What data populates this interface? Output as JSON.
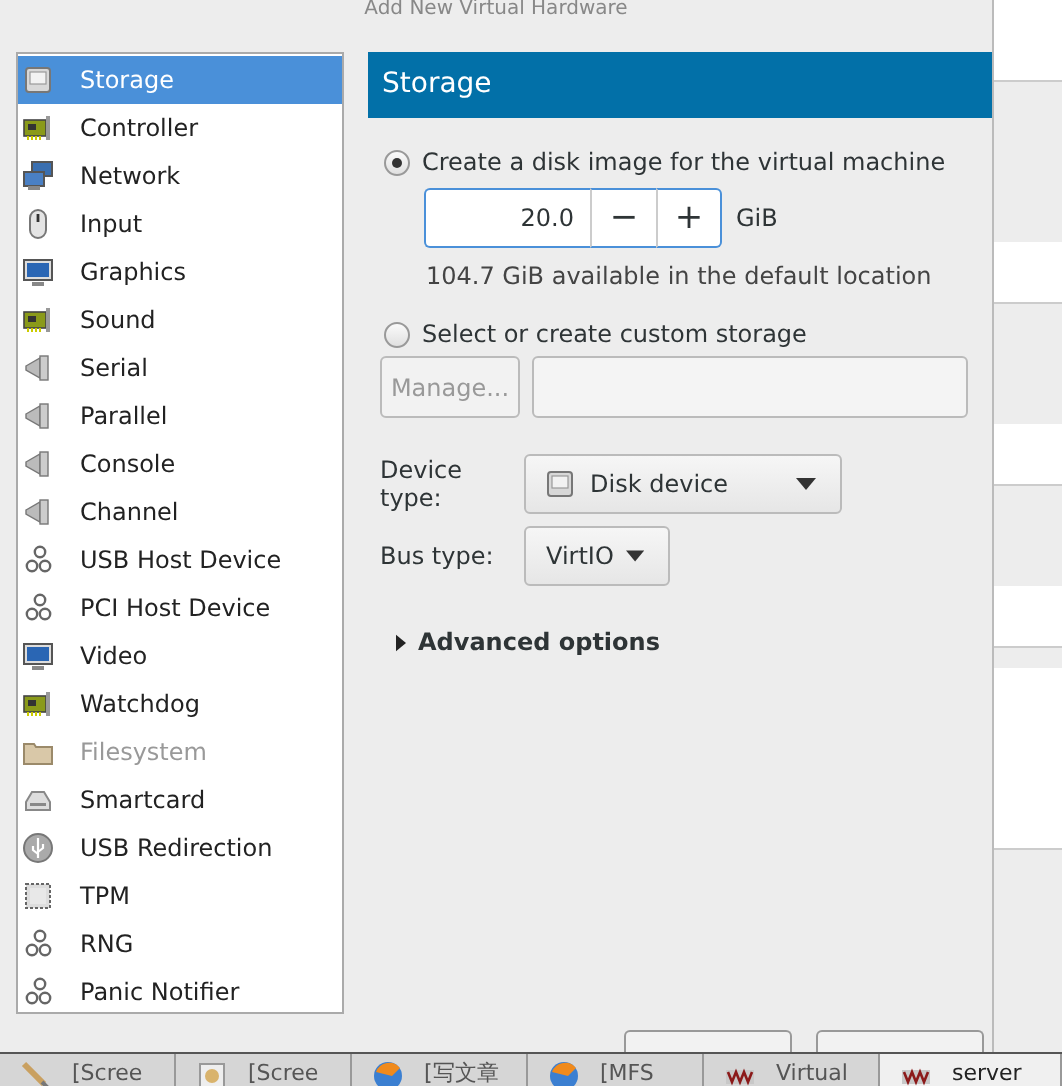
{
  "window": {
    "title": "Add New Virtual Hardware"
  },
  "hardware_list": [
    {
      "label": "Storage",
      "kind": "disk",
      "selected": true,
      "disabled": false
    },
    {
      "label": "Controller",
      "kind": "card",
      "selected": false,
      "disabled": false
    },
    {
      "label": "Network",
      "kind": "network",
      "selected": false,
      "disabled": false
    },
    {
      "label": "Input",
      "kind": "mouse",
      "selected": false,
      "disabled": false
    },
    {
      "label": "Graphics",
      "kind": "monitor",
      "selected": false,
      "disabled": false
    },
    {
      "label": "Sound",
      "kind": "card",
      "selected": false,
      "disabled": false
    },
    {
      "label": "Serial",
      "kind": "port",
      "selected": false,
      "disabled": false
    },
    {
      "label": "Parallel",
      "kind": "port",
      "selected": false,
      "disabled": false
    },
    {
      "label": "Console",
      "kind": "port",
      "selected": false,
      "disabled": false
    },
    {
      "label": "Channel",
      "kind": "port",
      "selected": false,
      "disabled": false
    },
    {
      "label": "USB Host Device",
      "kind": "gears",
      "selected": false,
      "disabled": false
    },
    {
      "label": "PCI Host Device",
      "kind": "gears",
      "selected": false,
      "disabled": false
    },
    {
      "label": "Video",
      "kind": "monitor",
      "selected": false,
      "disabled": false
    },
    {
      "label": "Watchdog",
      "kind": "card",
      "selected": false,
      "disabled": false
    },
    {
      "label": "Filesystem",
      "kind": "folder",
      "selected": false,
      "disabled": true
    },
    {
      "label": "Smartcard",
      "kind": "smartcard",
      "selected": false,
      "disabled": false
    },
    {
      "label": "USB Redirection",
      "kind": "usb",
      "selected": false,
      "disabled": false
    },
    {
      "label": "TPM",
      "kind": "chip",
      "selected": false,
      "disabled": false
    },
    {
      "label": "RNG",
      "kind": "gears",
      "selected": false,
      "disabled": false
    },
    {
      "label": "Panic Notifier",
      "kind": "gears",
      "selected": false,
      "disabled": false
    }
  ],
  "storage": {
    "header": "Storage",
    "create_option": {
      "label": "Create a disk image for the virtual machine",
      "selected": true
    },
    "size": {
      "value": "20.0",
      "minus": "−",
      "plus": "+",
      "unit": "GiB"
    },
    "available": "104.7 GiB available in the default location",
    "custom_option": {
      "label": "Select or create custom storage",
      "selected": false
    },
    "manage_button": {
      "label": "Manage...",
      "disabled": true
    },
    "device_type": {
      "label": "Device type:",
      "value": "Disk device"
    },
    "bus_type": {
      "label": "Bus type:",
      "value": "VirtIO"
    },
    "advanced": {
      "label": "Advanced options",
      "expanded": false
    }
  },
  "taskbar": [
    {
      "label": "[Scree",
      "kind": "brush",
      "selected": false
    },
    {
      "label": "[Scree",
      "kind": "image",
      "selected": false
    },
    {
      "label": "[写文章",
      "kind": "browser",
      "selected": false
    },
    {
      "label": "[MFS",
      "kind": "browser",
      "selected": false
    },
    {
      "label": "Virtual",
      "kind": "vm",
      "selected": false
    },
    {
      "label": "server",
      "kind": "vm",
      "selected": true
    }
  ]
}
